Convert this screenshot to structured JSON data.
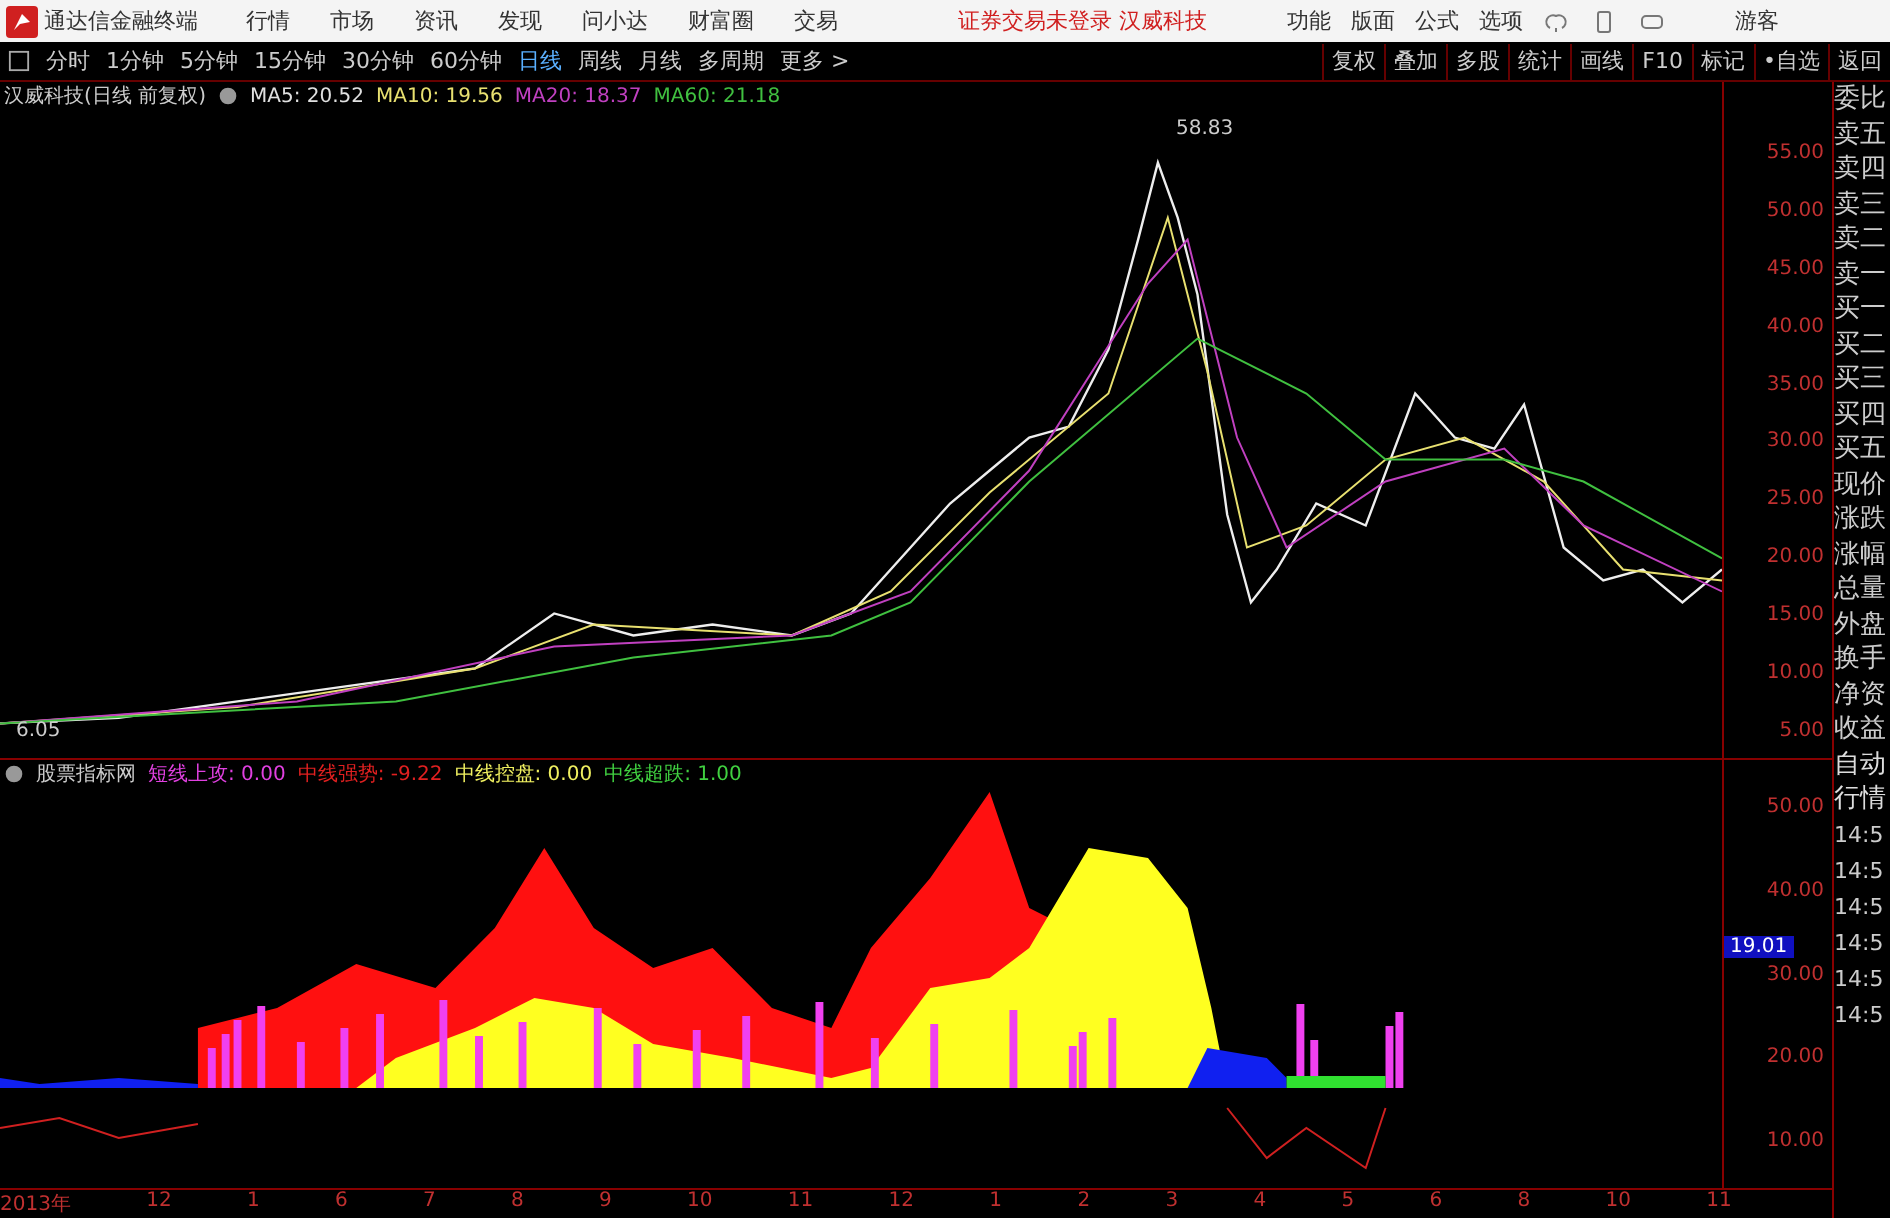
{
  "menubar": {
    "app_name": "通达信金融终端",
    "menu": [
      "行情",
      "市场",
      "资讯",
      "发现",
      "问小达",
      "财富圈",
      "交易"
    ],
    "notice": "证券交易未登录 汉威科技",
    "right_menu": [
      "功能",
      "版面",
      "公式",
      "选项"
    ],
    "user": "游客"
  },
  "toolbar": {
    "periods": [
      {
        "label": "分时",
        "selected": false
      },
      {
        "label": "1分钟",
        "selected": false
      },
      {
        "label": "5分钟",
        "selected": false
      },
      {
        "label": "15分钟",
        "selected": false
      },
      {
        "label": "30分钟",
        "selected": false
      },
      {
        "label": "60分钟",
        "selected": false
      },
      {
        "label": "日线",
        "selected": true
      },
      {
        "label": "周线",
        "selected": false
      },
      {
        "label": "月线",
        "selected": false
      },
      {
        "label": "多周期",
        "selected": false
      },
      {
        "label": "更多 >",
        "selected": false
      }
    ],
    "buttons": [
      "复权",
      "叠加",
      "多股",
      "统计",
      "画线",
      "F10",
      "标记",
      "•自选",
      "返回"
    ]
  },
  "main_chart": {
    "title": "汉威科技(日线 前复权)",
    "indicators": [
      {
        "label": "MA5: 20.52",
        "color": "#e0e0e0"
      },
      {
        "label": "MA10: 19.56",
        "color": "#e8e070"
      },
      {
        "label": "MA20: 18.37",
        "color": "#c040c0"
      },
      {
        "label": "MA60: 21.18",
        "color": "#40c040"
      }
    ],
    "high_label": "58.83",
    "low_label": "6.05",
    "y_ticks": [
      "55.00",
      "50.00",
      "45.00",
      "40.00",
      "35.00",
      "30.00",
      "25.00",
      "20.00",
      "15.00",
      "10.00",
      "5.00"
    ]
  },
  "sub_chart": {
    "title": "股票指标网",
    "indicators": [
      {
        "label": "短线上攻: 0.00",
        "color": "#e040e0"
      },
      {
        "label": "中线强势: -9.22",
        "color": "#e02020"
      },
      {
        "label": "中线控盘: 0.00",
        "color": "#f0f060"
      },
      {
        "label": "中线超跌: 1.00",
        "color": "#40d040"
      }
    ],
    "y_ticks": [
      "50.00",
      "40.00",
      "30.00",
      "20.00",
      "10.00"
    ],
    "cursor_value": "19.01"
  },
  "x_axis": [
    "2013年",
    "12",
    "1",
    "6",
    "7",
    "8",
    "9",
    "10",
    "11",
    "12",
    "1",
    "2",
    "3",
    "4",
    "5",
    "6",
    "8",
    "10",
    "11"
  ],
  "side_panel": {
    "labels": [
      "委比",
      "卖五",
      "卖四",
      "卖三",
      "卖二",
      "卖一",
      "买一",
      "买二",
      "买三",
      "买四",
      "买五",
      "现价",
      "涨跌",
      "涨幅",
      "总量",
      "外盘",
      "换手",
      "净资",
      "收益"
    ],
    "tabs": [
      "自动",
      "行情"
    ],
    "times": [
      "14:5",
      "14:5",
      "14:5",
      "14:5",
      "14:5",
      "14:5"
    ]
  }
}
